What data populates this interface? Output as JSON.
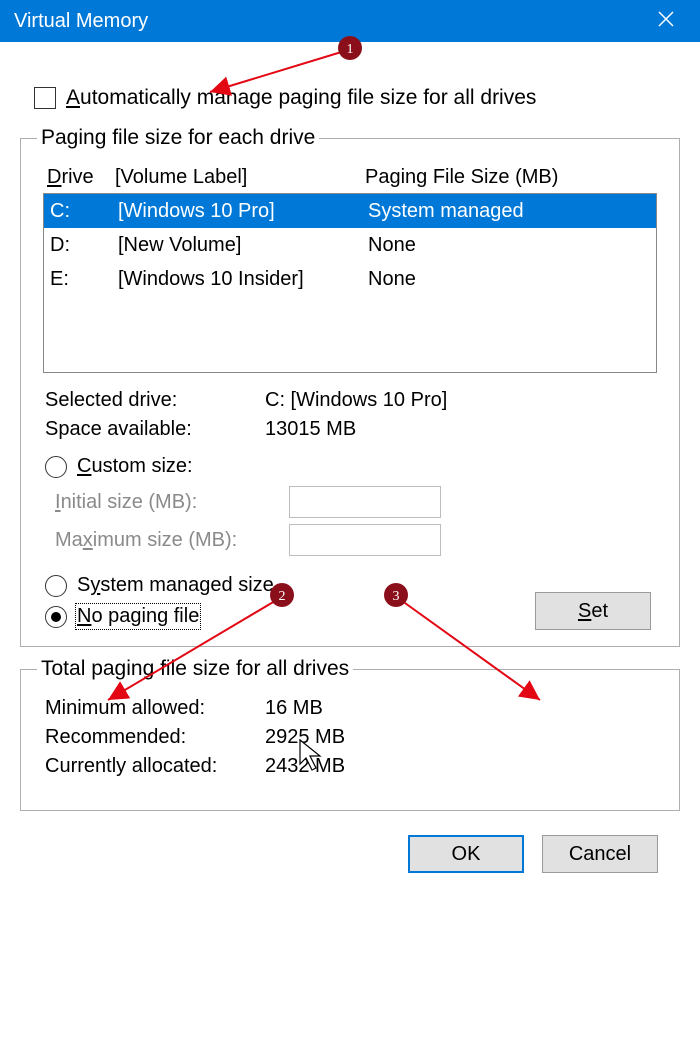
{
  "title": "Virtual Memory",
  "auto_manage_label_pre": "A",
  "auto_manage_label_rest": "utomatically manage paging file size for all drives",
  "auto_manage_checked": false,
  "group1_legend": "Paging file size for each drive",
  "columns": {
    "drive_u": "D",
    "drive_rest": "rive",
    "volume": "[Volume Label]",
    "size": "Paging File Size (MB)"
  },
  "drives": [
    {
      "letter": "C:",
      "label": "[Windows 10 Pro]",
      "size": "System managed",
      "selected": true
    },
    {
      "letter": "D:",
      "label": "[New Volume]",
      "size": "None",
      "selected": false
    },
    {
      "letter": "E:",
      "label": "[Windows 10 Insider]",
      "size": "None",
      "selected": false
    }
  ],
  "selected_drive_label": "Selected drive:",
  "selected_drive_value": "C:  [Windows 10 Pro]",
  "space_available_label": "Space available:",
  "space_available_value": "13015 MB",
  "radio_custom_u": "C",
  "radio_custom_rest": "ustom size:",
  "initial_label_u": "I",
  "initial_label_rest": "nitial size (MB):",
  "maximum_label": "Ma",
  "maximum_u": "x",
  "maximum_rest": "imum size (MB):",
  "radio_system_u": "y",
  "radio_system_pre": "S",
  "radio_system_rest": "stem managed size",
  "radio_none_u": "N",
  "radio_none_rest": "o paging file",
  "selected_radio": "none",
  "set_button_u": "S",
  "set_button_rest": "et",
  "group2_legend": "Total paging file size for all drives",
  "min_allowed_label": "Minimum allowed:",
  "min_allowed_value": "16 MB",
  "recommended_label": "Recommended:",
  "recommended_value": "2925 MB",
  "current_label": "Currently allocated:",
  "current_value": "2432 MB",
  "ok_label": "OK",
  "cancel_label": "Cancel",
  "annotations": {
    "1": "1",
    "2": "2",
    "3": "3"
  }
}
